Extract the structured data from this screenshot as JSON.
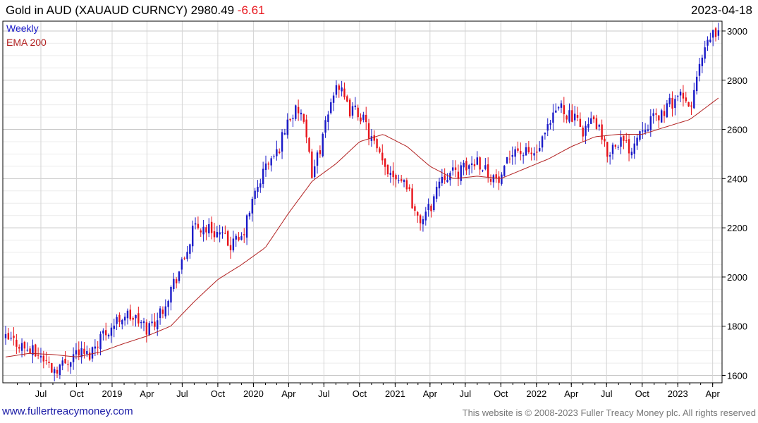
{
  "header": {
    "title": "Gold in AUD (XAUAUD CURNCY) 2980.49",
    "change": "-6.61",
    "date": "2023-04-18"
  },
  "footer": {
    "link": "www.fullertreacymoney.com",
    "copyright": "This website is © 2008-2023 Fuller Treacy Money plc. All rights reserved"
  },
  "colors": {
    "up": "#1a1ac8",
    "down": "#e8141b",
    "ema": "#b22222",
    "grid": "#d9d9d9",
    "axis": "#000000"
  },
  "chart_data": {
    "type": "candlestick",
    "legend": [
      "Weekly",
      "EMA 200"
    ],
    "legend_placement": "top-left",
    "ylim": [
      1570,
      3040
    ],
    "yticks": [
      1600,
      1800,
      2000,
      2200,
      2400,
      2600,
      2800,
      3000
    ],
    "xlim": [
      "2018-04-01",
      "2023-04-18"
    ],
    "xticks": [
      {
        "date": "2018-07-01",
        "label": "Jul"
      },
      {
        "date": "2018-10-01",
        "label": "Oct"
      },
      {
        "date": "2019-01-01",
        "label": "2019"
      },
      {
        "date": "2019-04-01",
        "label": "Apr"
      },
      {
        "date": "2019-07-01",
        "label": "Jul"
      },
      {
        "date": "2019-10-01",
        "label": "Oct"
      },
      {
        "date": "2020-01-01",
        "label": "2020"
      },
      {
        "date": "2020-04-01",
        "label": "Apr"
      },
      {
        "date": "2020-07-01",
        "label": "Jul"
      },
      {
        "date": "2020-10-01",
        "label": "Oct"
      },
      {
        "date": "2021-01-01",
        "label": "2021"
      },
      {
        "date": "2021-04-01",
        "label": "Apr"
      },
      {
        "date": "2021-07-01",
        "label": "Jul"
      },
      {
        "date": "2021-10-01",
        "label": "Oct"
      },
      {
        "date": "2022-01-01",
        "label": "2022"
      },
      {
        "date": "2022-04-01",
        "label": "Apr"
      },
      {
        "date": "2022-07-01",
        "label": "Jul"
      },
      {
        "date": "2022-10-01",
        "label": "Oct"
      },
      {
        "date": "2023-01-01",
        "label": "2023"
      },
      {
        "date": "2023-04-01",
        "label": "Apr"
      }
    ],
    "price_path": [
      [
        "2018-04-01",
        1745
      ],
      [
        "2018-05-01",
        1735
      ],
      [
        "2018-06-01",
        1700
      ],
      [
        "2018-07-01",
        1680
      ],
      [
        "2018-08-01",
        1625
      ],
      [
        "2018-09-01",
        1650
      ],
      [
        "2018-10-01",
        1700
      ],
      [
        "2018-11-01",
        1680
      ],
      [
        "2018-12-01",
        1760
      ],
      [
        "2019-01-01",
        1800
      ],
      [
        "2019-02-01",
        1850
      ],
      [
        "2019-03-01",
        1830
      ],
      [
        "2019-04-01",
        1790
      ],
      [
        "2019-05-01",
        1840
      ],
      [
        "2019-06-01",
        1950
      ],
      [
        "2019-07-01",
        2050
      ],
      [
        "2019-08-01",
        2200
      ],
      [
        "2019-09-01",
        2200
      ],
      [
        "2019-10-01",
        2180
      ],
      [
        "2019-11-01",
        2130
      ],
      [
        "2019-12-01",
        2150
      ],
      [
        "2020-01-01",
        2320
      ],
      [
        "2020-02-01",
        2450
      ],
      [
        "2020-03-01",
        2500
      ],
      [
        "2020-04-01",
        2650
      ],
      [
        "2020-05-01",
        2680
      ],
      [
        "2020-06-01",
        2420
      ],
      [
        "2020-07-01",
        2580
      ],
      [
        "2020-08-01",
        2800
      ],
      [
        "2020-09-01",
        2680
      ],
      [
        "2020-10-01",
        2670
      ],
      [
        "2020-11-01",
        2560
      ],
      [
        "2020-12-01",
        2450
      ],
      [
        "2021-01-01",
        2420
      ],
      [
        "2021-02-01",
        2380
      ],
      [
        "2021-03-01",
        2220
      ],
      [
        "2021-04-01",
        2280
      ],
      [
        "2021-05-01",
        2420
      ],
      [
        "2021-06-01",
        2420
      ],
      [
        "2021-07-01",
        2440
      ],
      [
        "2021-08-01",
        2480
      ],
      [
        "2021-09-01",
        2420
      ],
      [
        "2021-10-01",
        2380
      ],
      [
        "2021-11-01",
        2530
      ],
      [
        "2021-12-01",
        2500
      ],
      [
        "2022-01-01",
        2500
      ],
      [
        "2022-02-01",
        2600
      ],
      [
        "2022-03-01",
        2700
      ],
      [
        "2022-04-01",
        2650
      ],
      [
        "2022-05-01",
        2600
      ],
      [
        "2022-06-01",
        2640
      ],
      [
        "2022-07-01",
        2500
      ],
      [
        "2022-08-01",
        2560
      ],
      [
        "2022-09-01",
        2520
      ],
      [
        "2022-10-01",
        2620
      ],
      [
        "2022-11-01",
        2640
      ],
      [
        "2022-12-01",
        2680
      ],
      [
        "2023-01-01",
        2740
      ],
      [
        "2023-02-01",
        2680
      ],
      [
        "2023-03-01",
        2870
      ],
      [
        "2023-04-01",
        2990
      ],
      [
        "2023-04-18",
        2980.49
      ]
    ],
    "ema_path": [
      [
        "2018-04-01",
        1675
      ],
      [
        "2018-06-01",
        1690
      ],
      [
        "2018-08-01",
        1685
      ],
      [
        "2018-10-01",
        1675
      ],
      [
        "2018-12-01",
        1695
      ],
      [
        "2019-02-01",
        1730
      ],
      [
        "2019-04-01",
        1760
      ],
      [
        "2019-06-01",
        1800
      ],
      [
        "2019-08-01",
        1900
      ],
      [
        "2019-10-01",
        1990
      ],
      [
        "2019-12-01",
        2050
      ],
      [
        "2020-02-01",
        2120
      ],
      [
        "2020-04-01",
        2260
      ],
      [
        "2020-06-01",
        2390
      ],
      [
        "2020-08-01",
        2460
      ],
      [
        "2020-10-01",
        2550
      ],
      [
        "2020-12-01",
        2580
      ],
      [
        "2021-02-01",
        2530
      ],
      [
        "2021-04-01",
        2450
      ],
      [
        "2021-06-01",
        2400
      ],
      [
        "2021-08-01",
        2410
      ],
      [
        "2021-10-01",
        2400
      ],
      [
        "2021-12-01",
        2440
      ],
      [
        "2022-02-01",
        2480
      ],
      [
        "2022-04-01",
        2530
      ],
      [
        "2022-06-01",
        2570
      ],
      [
        "2022-08-01",
        2580
      ],
      [
        "2022-10-01",
        2580
      ],
      [
        "2022-12-01",
        2610
      ],
      [
        "2023-02-01",
        2640
      ],
      [
        "2023-04-18",
        2730
      ]
    ]
  }
}
